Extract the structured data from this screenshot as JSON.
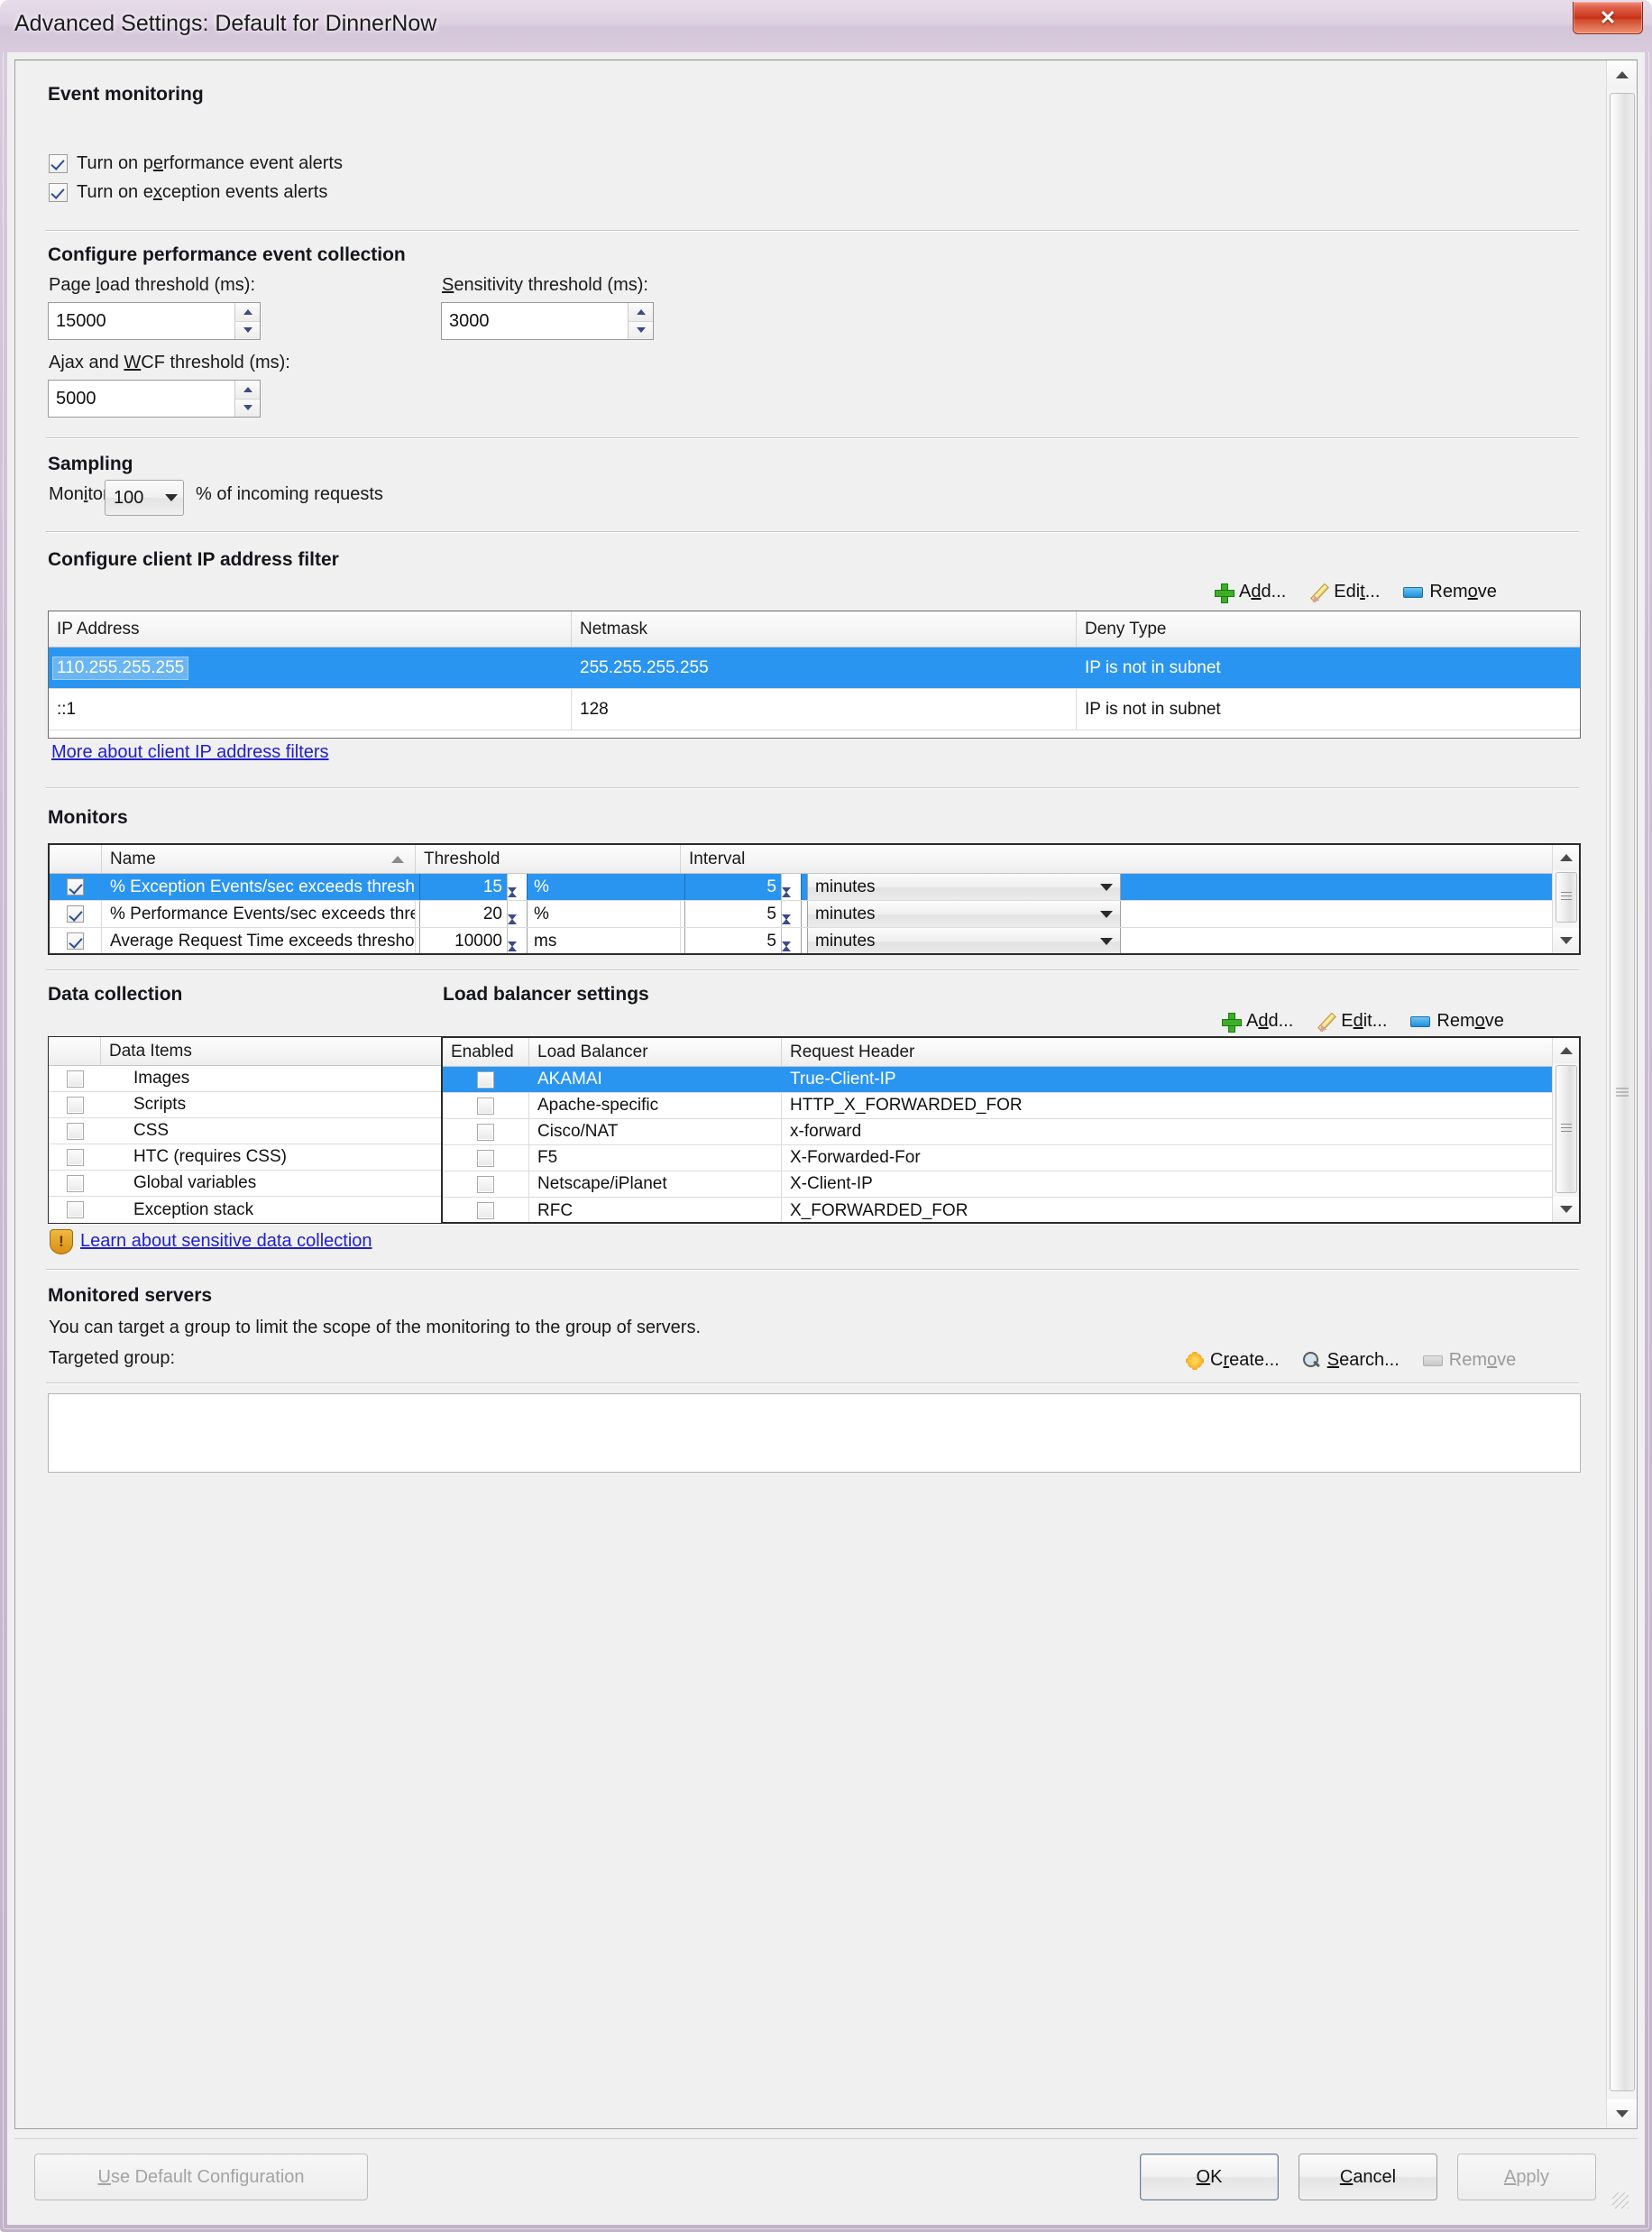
{
  "window": {
    "title": "Advanced Settings: Default for DinnerNow",
    "close_label": "✕"
  },
  "event_monitoring": {
    "heading": "Event monitoring",
    "options": [
      {
        "label": "Turn on performance event alerts",
        "checked": true
      },
      {
        "label": "Turn on exception events alerts",
        "checked": true
      }
    ]
  },
  "performance_collection": {
    "heading": "Configure performance event collection",
    "page_load_label": "Page load threshold (ms):",
    "page_load_value": "15000",
    "sensitivity_label": "Sensitivity threshold (ms):",
    "sensitivity_value": "3000",
    "ajax_label": "Ajax and WCF threshold (ms):",
    "ajax_value": "5000"
  },
  "sampling": {
    "heading": "Sampling",
    "monitor_label": "Monitor",
    "percent_value": "100",
    "suffix_label": "% of incoming requests"
  },
  "ip_filter": {
    "heading": "Configure client IP address filter",
    "toolbar": {
      "add": "Add...",
      "edit": "Edit...",
      "remove": "Remove"
    },
    "columns": [
      "IP Address",
      "Netmask",
      "Deny Type"
    ],
    "rows": [
      {
        "ip": "110.255.255.255",
        "netmask": "255.255.255.255",
        "deny": "IP is not in subnet",
        "selected": true
      },
      {
        "ip": "::1",
        "netmask": "128",
        "deny": "IP is not in subnet",
        "selected": false
      }
    ],
    "link": "More about client IP address filters"
  },
  "monitors": {
    "heading": "Monitors",
    "columns": [
      "Name",
      "Threshold",
      "Interval"
    ],
    "rows": [
      {
        "checked": true,
        "name": "% Exception Events/sec exceeds threshold",
        "threshold": "15",
        "unit": "%",
        "interval": "5",
        "interval_unit": "minutes",
        "selected": true
      },
      {
        "checked": true,
        "name": "% Performance Events/sec exceeds threshold",
        "threshold": "20",
        "unit": "%",
        "interval": "5",
        "interval_unit": "minutes",
        "selected": false
      },
      {
        "checked": true,
        "name": "Average Request Time exceeds threshold",
        "threshold": "10000",
        "unit": "ms",
        "interval": "5",
        "interval_unit": "minutes",
        "selected": false
      }
    ]
  },
  "data_collection": {
    "heading": "Data collection",
    "column": "Data Items",
    "items": [
      {
        "label": "Images",
        "checked": false
      },
      {
        "label": "Scripts",
        "checked": false
      },
      {
        "label": "CSS",
        "checked": false
      },
      {
        "label": "HTC (requires CSS)",
        "checked": false
      },
      {
        "label": "Global variables",
        "checked": false
      },
      {
        "label": "Exception stack",
        "checked": false
      }
    ],
    "link": "Learn about sensitive data collection"
  },
  "load_balancer": {
    "heading": "Load balancer settings",
    "toolbar": {
      "add": "Add...",
      "edit": "Edit...",
      "remove": "Remove"
    },
    "columns": [
      "Enabled",
      "Load Balancer",
      "Request Header"
    ],
    "rows": [
      {
        "enabled": false,
        "name": "AKAMAI",
        "header": "True-Client-IP",
        "selected": true
      },
      {
        "enabled": false,
        "name": "Apache-specific",
        "header": "HTTP_X_FORWARDED_FOR",
        "selected": false
      },
      {
        "enabled": false,
        "name": "Cisco/NAT",
        "header": "x-forward",
        "selected": false
      },
      {
        "enabled": false,
        "name": "F5",
        "header": "X-Forwarded-For",
        "selected": false
      },
      {
        "enabled": false,
        "name": "Netscape/iPlanet",
        "header": "X-Client-IP",
        "selected": false
      },
      {
        "enabled": false,
        "name": "RFC",
        "header": "X_FORWARDED_FOR",
        "selected": false
      }
    ]
  },
  "monitored_servers": {
    "heading": "Monitored servers",
    "description": "You can target a group to limit the scope of the monitoring to the group of servers.",
    "targeted_group_label": "Targeted group:",
    "targeted_group_value": "",
    "toolbar": {
      "create": "Create...",
      "search": "Search...",
      "remove": "Remove"
    }
  },
  "buttons": {
    "use_default": "Use Default Configuration",
    "ok": "OK",
    "cancel": "Cancel",
    "apply": "Apply"
  }
}
